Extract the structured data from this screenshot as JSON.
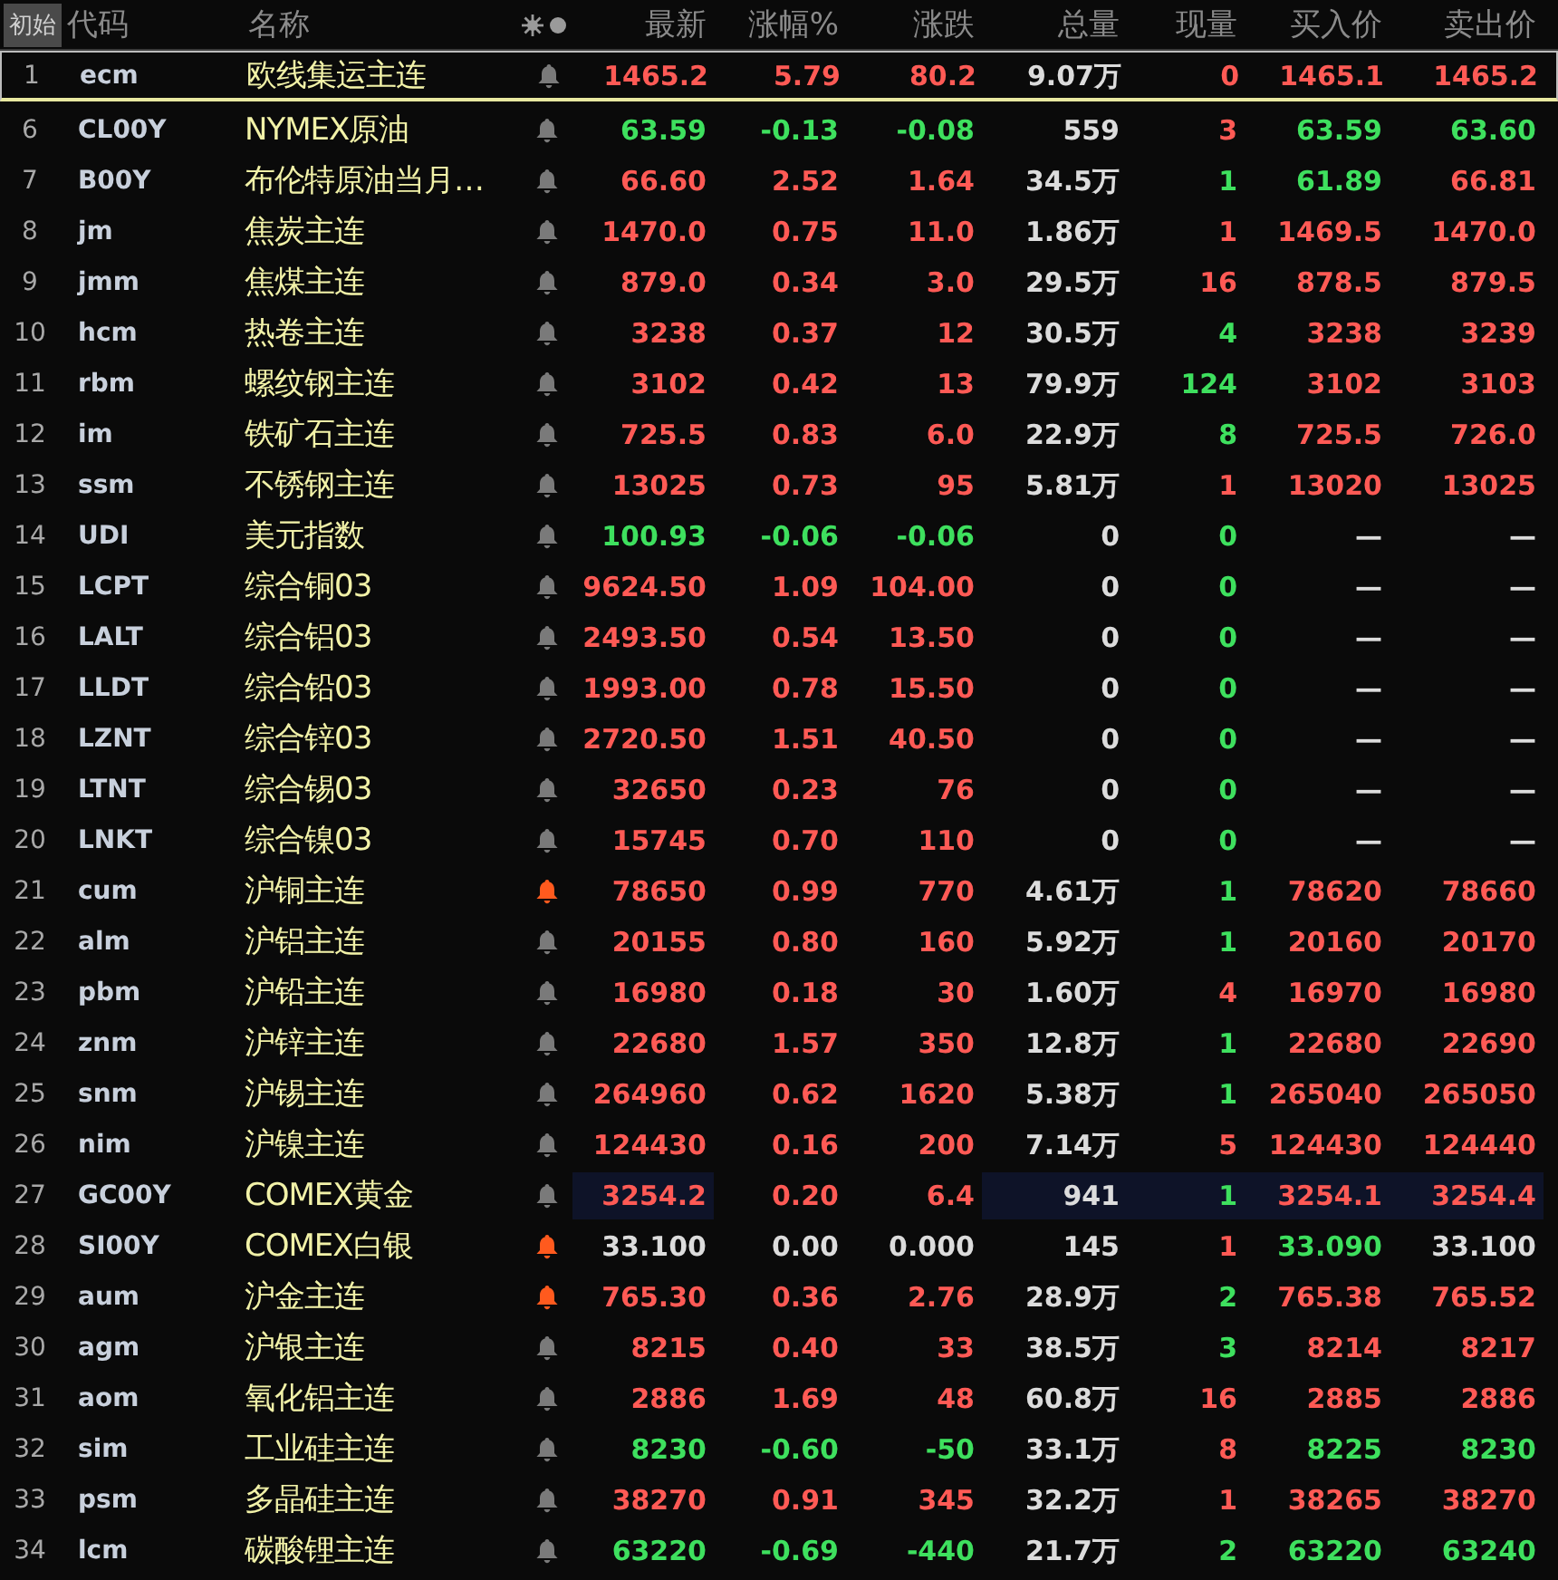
{
  "header": {
    "start_button": "初始",
    "columns": {
      "code": "代码",
      "name": "名称",
      "last": "最新",
      "pct": "涨幅%",
      "chg": "涨跌",
      "volume": "总量",
      "qty": "现量",
      "bid": "买入价",
      "ask": "卖出价"
    }
  },
  "rows": [
    {
      "no": "1",
      "code": "ecm",
      "name": "欧线集运主连",
      "alert": false,
      "selected": true,
      "last": {
        "text": "1465.2",
        "color": "#ff5a55"
      },
      "pct": {
        "text": "5.79",
        "color": "#ff5a55"
      },
      "chg": {
        "text": "80.2",
        "color": "#ff5a55"
      },
      "volume": "9.07万",
      "qty": {
        "text": "0",
        "color": "#ff5a55"
      },
      "bid": {
        "text": "1465.1",
        "color": "#ff5a55"
      },
      "ask": {
        "text": "1465.2",
        "color": "#ff5a55"
      },
      "highlighted": false
    },
    {
      "no": "6",
      "code": "CL00Y",
      "name": "NYMEX原油",
      "alert": false,
      "selected": false,
      "last": {
        "text": "63.59",
        "color": "#3ee05e"
      },
      "pct": {
        "text": "-0.13",
        "color": "#3ee05e"
      },
      "chg": {
        "text": "-0.08",
        "color": "#3ee05e"
      },
      "volume": "559",
      "qty": {
        "text": "3",
        "color": "#ff5a55"
      },
      "bid": {
        "text": "63.59",
        "color": "#3ee05e"
      },
      "ask": {
        "text": "63.60",
        "color": "#3ee05e"
      },
      "highlighted": false
    },
    {
      "no": "7",
      "code": "B00Y",
      "name": "布伦特原油当月…",
      "alert": false,
      "selected": false,
      "last": {
        "text": "66.60",
        "color": "#ff5a55"
      },
      "pct": {
        "text": "2.52",
        "color": "#ff5a55"
      },
      "chg": {
        "text": "1.64",
        "color": "#ff5a55"
      },
      "volume": "34.5万",
      "qty": {
        "text": "1",
        "color": "#3ee05e"
      },
      "bid": {
        "text": "61.89",
        "color": "#3ee05e"
      },
      "ask": {
        "text": "66.81",
        "color": "#ff5a55"
      },
      "highlighted": false
    },
    {
      "no": "8",
      "code": "jm",
      "name": "焦炭主连",
      "alert": false,
      "selected": false,
      "last": {
        "text": "1470.0",
        "color": "#ff5a55"
      },
      "pct": {
        "text": "0.75",
        "color": "#ff5a55"
      },
      "chg": {
        "text": "11.0",
        "color": "#ff5a55"
      },
      "volume": "1.86万",
      "qty": {
        "text": "1",
        "color": "#ff5a55"
      },
      "bid": {
        "text": "1469.5",
        "color": "#ff5a55"
      },
      "ask": {
        "text": "1470.0",
        "color": "#ff5a55"
      },
      "highlighted": false
    },
    {
      "no": "9",
      "code": "jmm",
      "name": "焦煤主连",
      "alert": false,
      "selected": false,
      "last": {
        "text": "879.0",
        "color": "#ff5a55"
      },
      "pct": {
        "text": "0.34",
        "color": "#ff5a55"
      },
      "chg": {
        "text": "3.0",
        "color": "#ff5a55"
      },
      "volume": "29.5万",
      "qty": {
        "text": "16",
        "color": "#ff5a55"
      },
      "bid": {
        "text": "878.5",
        "color": "#ff5a55"
      },
      "ask": {
        "text": "879.5",
        "color": "#ff5a55"
      },
      "highlighted": false
    },
    {
      "no": "10",
      "code": "hcm",
      "name": "热卷主连",
      "alert": false,
      "selected": false,
      "last": {
        "text": "3238",
        "color": "#ff5a55"
      },
      "pct": {
        "text": "0.37",
        "color": "#ff5a55"
      },
      "chg": {
        "text": "12",
        "color": "#ff5a55"
      },
      "volume": "30.5万",
      "qty": {
        "text": "4",
        "color": "#3ee05e"
      },
      "bid": {
        "text": "3238",
        "color": "#ff5a55"
      },
      "ask": {
        "text": "3239",
        "color": "#ff5a55"
      },
      "highlighted": false
    },
    {
      "no": "11",
      "code": "rbm",
      "name": "螺纹钢主连",
      "alert": false,
      "selected": false,
      "last": {
        "text": "3102",
        "color": "#ff5a55"
      },
      "pct": {
        "text": "0.42",
        "color": "#ff5a55"
      },
      "chg": {
        "text": "13",
        "color": "#ff5a55"
      },
      "volume": "79.9万",
      "qty": {
        "text": "124",
        "color": "#3ee05e"
      },
      "bid": {
        "text": "3102",
        "color": "#ff5a55"
      },
      "ask": {
        "text": "3103",
        "color": "#ff5a55"
      },
      "highlighted": false
    },
    {
      "no": "12",
      "code": "im",
      "name": "铁矿石主连",
      "alert": false,
      "selected": false,
      "last": {
        "text": "725.5",
        "color": "#ff5a55"
      },
      "pct": {
        "text": "0.83",
        "color": "#ff5a55"
      },
      "chg": {
        "text": "6.0",
        "color": "#ff5a55"
      },
      "volume": "22.9万",
      "qty": {
        "text": "8",
        "color": "#3ee05e"
      },
      "bid": {
        "text": "725.5",
        "color": "#ff5a55"
      },
      "ask": {
        "text": "726.0",
        "color": "#ff5a55"
      },
      "highlighted": false
    },
    {
      "no": "13",
      "code": "ssm",
      "name": "不锈钢主连",
      "alert": false,
      "selected": false,
      "last": {
        "text": "13025",
        "color": "#ff5a55"
      },
      "pct": {
        "text": "0.73",
        "color": "#ff5a55"
      },
      "chg": {
        "text": "95",
        "color": "#ff5a55"
      },
      "volume": "5.81万",
      "qty": {
        "text": "1",
        "color": "#ff5a55"
      },
      "bid": {
        "text": "13020",
        "color": "#ff5a55"
      },
      "ask": {
        "text": "13025",
        "color": "#ff5a55"
      },
      "highlighted": false
    },
    {
      "no": "14",
      "code": "UDI",
      "name": "美元指数",
      "alert": false,
      "selected": false,
      "last": {
        "text": "100.93",
        "color": "#3ee05e"
      },
      "pct": {
        "text": "-0.06",
        "color": "#3ee05e"
      },
      "chg": {
        "text": "-0.06",
        "color": "#3ee05e"
      },
      "volume": "0",
      "qty": {
        "text": "0",
        "color": "#3ee05e"
      },
      "bid": {
        "text": "—",
        "color": "#dcdcdc"
      },
      "ask": {
        "text": "—",
        "color": "#dcdcdc"
      },
      "highlighted": false
    },
    {
      "no": "15",
      "code": "LCPT",
      "name": "综合铜03",
      "alert": false,
      "selected": false,
      "last": {
        "text": "9624.50",
        "color": "#ff5a55"
      },
      "pct": {
        "text": "1.09",
        "color": "#ff5a55"
      },
      "chg": {
        "text": "104.00",
        "color": "#ff5a55"
      },
      "volume": "0",
      "qty": {
        "text": "0",
        "color": "#3ee05e"
      },
      "bid": {
        "text": "—",
        "color": "#dcdcdc"
      },
      "ask": {
        "text": "—",
        "color": "#dcdcdc"
      },
      "highlighted": false
    },
    {
      "no": "16",
      "code": "LALT",
      "name": "综合铝03",
      "alert": false,
      "selected": false,
      "last": {
        "text": "2493.50",
        "color": "#ff5a55"
      },
      "pct": {
        "text": "0.54",
        "color": "#ff5a55"
      },
      "chg": {
        "text": "13.50",
        "color": "#ff5a55"
      },
      "volume": "0",
      "qty": {
        "text": "0",
        "color": "#3ee05e"
      },
      "bid": {
        "text": "—",
        "color": "#dcdcdc"
      },
      "ask": {
        "text": "—",
        "color": "#dcdcdc"
      },
      "highlighted": false
    },
    {
      "no": "17",
      "code": "LLDT",
      "name": "综合铅03",
      "alert": false,
      "selected": false,
      "last": {
        "text": "1993.00",
        "color": "#ff5a55"
      },
      "pct": {
        "text": "0.78",
        "color": "#ff5a55"
      },
      "chg": {
        "text": "15.50",
        "color": "#ff5a55"
      },
      "volume": "0",
      "qty": {
        "text": "0",
        "color": "#3ee05e"
      },
      "bid": {
        "text": "—",
        "color": "#dcdcdc"
      },
      "ask": {
        "text": "—",
        "color": "#dcdcdc"
      },
      "highlighted": false
    },
    {
      "no": "18",
      "code": "LZNT",
      "name": "综合锌03",
      "alert": false,
      "selected": false,
      "last": {
        "text": "2720.50",
        "color": "#ff5a55"
      },
      "pct": {
        "text": "1.51",
        "color": "#ff5a55"
      },
      "chg": {
        "text": "40.50",
        "color": "#ff5a55"
      },
      "volume": "0",
      "qty": {
        "text": "0",
        "color": "#3ee05e"
      },
      "bid": {
        "text": "—",
        "color": "#dcdcdc"
      },
      "ask": {
        "text": "—",
        "color": "#dcdcdc"
      },
      "highlighted": false
    },
    {
      "no": "19",
      "code": "LTNT",
      "name": "综合锡03",
      "alert": false,
      "selected": false,
      "last": {
        "text": "32650",
        "color": "#ff5a55"
      },
      "pct": {
        "text": "0.23",
        "color": "#ff5a55"
      },
      "chg": {
        "text": "76",
        "color": "#ff5a55"
      },
      "volume": "0",
      "qty": {
        "text": "0",
        "color": "#3ee05e"
      },
      "bid": {
        "text": "—",
        "color": "#dcdcdc"
      },
      "ask": {
        "text": "—",
        "color": "#dcdcdc"
      },
      "highlighted": false
    },
    {
      "no": "20",
      "code": "LNKT",
      "name": "综合镍03",
      "alert": false,
      "selected": false,
      "last": {
        "text": "15745",
        "color": "#ff5a55"
      },
      "pct": {
        "text": "0.70",
        "color": "#ff5a55"
      },
      "chg": {
        "text": "110",
        "color": "#ff5a55"
      },
      "volume": "0",
      "qty": {
        "text": "0",
        "color": "#3ee05e"
      },
      "bid": {
        "text": "—",
        "color": "#dcdcdc"
      },
      "ask": {
        "text": "—",
        "color": "#dcdcdc"
      },
      "highlighted": false
    },
    {
      "no": "21",
      "code": "cum",
      "name": "沪铜主连",
      "alert": true,
      "selected": false,
      "last": {
        "text": "78650",
        "color": "#ff5a55"
      },
      "pct": {
        "text": "0.99",
        "color": "#ff5a55"
      },
      "chg": {
        "text": "770",
        "color": "#ff5a55"
      },
      "volume": "4.61万",
      "qty": {
        "text": "1",
        "color": "#3ee05e"
      },
      "bid": {
        "text": "78620",
        "color": "#ff5a55"
      },
      "ask": {
        "text": "78660",
        "color": "#ff5a55"
      },
      "highlighted": false
    },
    {
      "no": "22",
      "code": "alm",
      "name": "沪铝主连",
      "alert": false,
      "selected": false,
      "last": {
        "text": "20155",
        "color": "#ff5a55"
      },
      "pct": {
        "text": "0.80",
        "color": "#ff5a55"
      },
      "chg": {
        "text": "160",
        "color": "#ff5a55"
      },
      "volume": "5.92万",
      "qty": {
        "text": "1",
        "color": "#3ee05e"
      },
      "bid": {
        "text": "20160",
        "color": "#ff5a55"
      },
      "ask": {
        "text": "20170",
        "color": "#ff5a55"
      },
      "highlighted": false
    },
    {
      "no": "23",
      "code": "pbm",
      "name": "沪铅主连",
      "alert": false,
      "selected": false,
      "last": {
        "text": "16980",
        "color": "#ff5a55"
      },
      "pct": {
        "text": "0.18",
        "color": "#ff5a55"
      },
      "chg": {
        "text": "30",
        "color": "#ff5a55"
      },
      "volume": "1.60万",
      "qty": {
        "text": "4",
        "color": "#ff5a55"
      },
      "bid": {
        "text": "16970",
        "color": "#ff5a55"
      },
      "ask": {
        "text": "16980",
        "color": "#ff5a55"
      },
      "highlighted": false
    },
    {
      "no": "24",
      "code": "znm",
      "name": "沪锌主连",
      "alert": false,
      "selected": false,
      "last": {
        "text": "22680",
        "color": "#ff5a55"
      },
      "pct": {
        "text": "1.57",
        "color": "#ff5a55"
      },
      "chg": {
        "text": "350",
        "color": "#ff5a55"
      },
      "volume": "12.8万",
      "qty": {
        "text": "1",
        "color": "#3ee05e"
      },
      "bid": {
        "text": "22680",
        "color": "#ff5a55"
      },
      "ask": {
        "text": "22690",
        "color": "#ff5a55"
      },
      "highlighted": false
    },
    {
      "no": "25",
      "code": "snm",
      "name": "沪锡主连",
      "alert": false,
      "selected": false,
      "last": {
        "text": "264960",
        "color": "#ff5a55"
      },
      "pct": {
        "text": "0.62",
        "color": "#ff5a55"
      },
      "chg": {
        "text": "1620",
        "color": "#ff5a55"
      },
      "volume": "5.38万",
      "qty": {
        "text": "1",
        "color": "#3ee05e"
      },
      "bid": {
        "text": "265040",
        "color": "#ff5a55"
      },
      "ask": {
        "text": "265050",
        "color": "#ff5a55"
      },
      "highlighted": false
    },
    {
      "no": "26",
      "code": "nim",
      "name": "沪镍主连",
      "alert": false,
      "selected": false,
      "last": {
        "text": "124430",
        "color": "#ff5a55"
      },
      "pct": {
        "text": "0.16",
        "color": "#ff5a55"
      },
      "chg": {
        "text": "200",
        "color": "#ff5a55"
      },
      "volume": "7.14万",
      "qty": {
        "text": "5",
        "color": "#ff5a55"
      },
      "bid": {
        "text": "124430",
        "color": "#ff5a55"
      },
      "ask": {
        "text": "124440",
        "color": "#ff5a55"
      },
      "highlighted": false
    },
    {
      "no": "27",
      "code": "GC00Y",
      "name": "COMEX黄金",
      "alert": false,
      "selected": false,
      "last": {
        "text": "3254.2",
        "color": "#ff5a55"
      },
      "pct": {
        "text": "0.20",
        "color": "#ff5a55"
      },
      "chg": {
        "text": "6.4",
        "color": "#ff5a55"
      },
      "volume": "941",
      "qty": {
        "text": "1",
        "color": "#3ee05e"
      },
      "bid": {
        "text": "3254.1",
        "color": "#ff5a55"
      },
      "ask": {
        "text": "3254.4",
        "color": "#ff5a55"
      },
      "highlighted": true
    },
    {
      "no": "28",
      "code": "SI00Y",
      "name": "COMEX白银",
      "alert": true,
      "selected": false,
      "last": {
        "text": "33.100",
        "color": "#dcdcdc"
      },
      "pct": {
        "text": "0.00",
        "color": "#dcdcdc"
      },
      "chg": {
        "text": "0.000",
        "color": "#dcdcdc"
      },
      "volume": "145",
      "qty": {
        "text": "1",
        "color": "#ff5a55"
      },
      "bid": {
        "text": "33.090",
        "color": "#3ee05e"
      },
      "ask": {
        "text": "33.100",
        "color": "#dcdcdc"
      },
      "highlighted": false
    },
    {
      "no": "29",
      "code": "aum",
      "name": "沪金主连",
      "alert": true,
      "selected": false,
      "last": {
        "text": "765.30",
        "color": "#ff5a55"
      },
      "pct": {
        "text": "0.36",
        "color": "#ff5a55"
      },
      "chg": {
        "text": "2.76",
        "color": "#ff5a55"
      },
      "volume": "28.9万",
      "qty": {
        "text": "2",
        "color": "#3ee05e"
      },
      "bid": {
        "text": "765.38",
        "color": "#ff5a55"
      },
      "ask": {
        "text": "765.52",
        "color": "#ff5a55"
      },
      "highlighted": false
    },
    {
      "no": "30",
      "code": "agm",
      "name": "沪银主连",
      "alert": false,
      "selected": false,
      "last": {
        "text": "8215",
        "color": "#ff5a55"
      },
      "pct": {
        "text": "0.40",
        "color": "#ff5a55"
      },
      "chg": {
        "text": "33",
        "color": "#ff5a55"
      },
      "volume": "38.5万",
      "qty": {
        "text": "3",
        "color": "#3ee05e"
      },
      "bid": {
        "text": "8214",
        "color": "#ff5a55"
      },
      "ask": {
        "text": "8217",
        "color": "#ff5a55"
      },
      "highlighted": false
    },
    {
      "no": "31",
      "code": "aom",
      "name": "氧化铝主连",
      "alert": false,
      "selected": false,
      "last": {
        "text": "2886",
        "color": "#ff5a55"
      },
      "pct": {
        "text": "1.69",
        "color": "#ff5a55"
      },
      "chg": {
        "text": "48",
        "color": "#ff5a55"
      },
      "volume": "60.8万",
      "qty": {
        "text": "16",
        "color": "#ff5a55"
      },
      "bid": {
        "text": "2885",
        "color": "#ff5a55"
      },
      "ask": {
        "text": "2886",
        "color": "#ff5a55"
      },
      "highlighted": false
    },
    {
      "no": "32",
      "code": "sim",
      "name": "工业硅主连",
      "alert": false,
      "selected": false,
      "last": {
        "text": "8230",
        "color": "#3ee05e"
      },
      "pct": {
        "text": "-0.60",
        "color": "#3ee05e"
      },
      "chg": {
        "text": "-50",
        "color": "#3ee05e"
      },
      "volume": "33.1万",
      "qty": {
        "text": "8",
        "color": "#ff5a55"
      },
      "bid": {
        "text": "8225",
        "color": "#3ee05e"
      },
      "ask": {
        "text": "8230",
        "color": "#3ee05e"
      },
      "highlighted": false
    },
    {
      "no": "33",
      "code": "psm",
      "name": "多晶硅主连",
      "alert": false,
      "selected": false,
      "last": {
        "text": "38270",
        "color": "#ff5a55"
      },
      "pct": {
        "text": "0.91",
        "color": "#ff5a55"
      },
      "chg": {
        "text": "345",
        "color": "#ff5a55"
      },
      "volume": "32.2万",
      "qty": {
        "text": "1",
        "color": "#ff5a55"
      },
      "bid": {
        "text": "38265",
        "color": "#ff5a55"
      },
      "ask": {
        "text": "38270",
        "color": "#ff5a55"
      },
      "highlighted": false
    },
    {
      "no": "34",
      "code": "lcm",
      "name": "碳酸锂主连",
      "alert": false,
      "selected": false,
      "last": {
        "text": "63220",
        "color": "#3ee05e"
      },
      "pct": {
        "text": "-0.69",
        "color": "#3ee05e"
      },
      "chg": {
        "text": "-440",
        "color": "#3ee05e"
      },
      "volume": "21.7万",
      "qty": {
        "text": "2",
        "color": "#3ee05e"
      },
      "bid": {
        "text": "63220",
        "color": "#3ee05e"
      },
      "ask": {
        "text": "63240",
        "color": "#3ee05e"
      },
      "highlighted": false
    }
  ]
}
